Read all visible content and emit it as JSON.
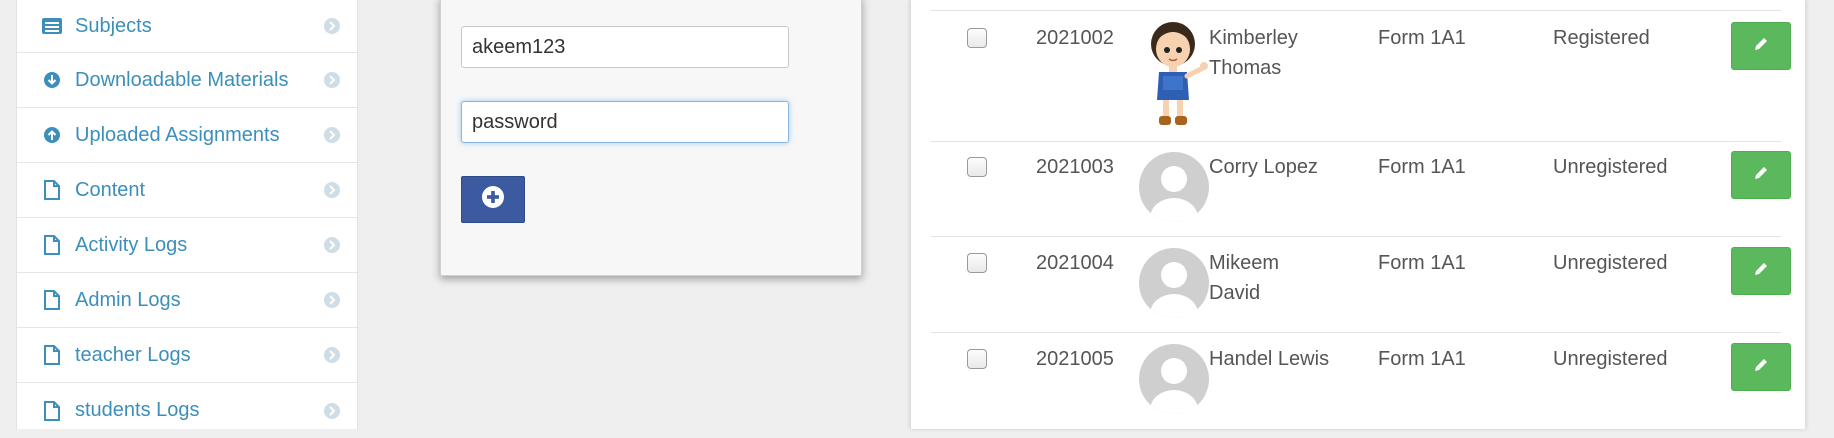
{
  "sidebar": {
    "items": [
      {
        "label": "Subjects",
        "icon": "list-icon"
      },
      {
        "label": "Downloadable Materials",
        "icon": "download-circle-icon"
      },
      {
        "label": "Uploaded Assignments",
        "icon": "upload-circle-icon"
      },
      {
        "label": "Content",
        "icon": "file-icon"
      },
      {
        "label": "Activity Logs",
        "icon": "file-icon"
      },
      {
        "label": "Admin Logs",
        "icon": "file-icon"
      },
      {
        "label": "teacher Logs",
        "icon": "file-icon"
      },
      {
        "label": "students Logs",
        "icon": "file-icon"
      }
    ]
  },
  "form": {
    "username_value": "akeem123",
    "password_value": "password"
  },
  "table": {
    "rows": [
      {
        "id": "2021002",
        "name": "Kimberley Thomas",
        "class": "Form 1A1",
        "status": "Registered",
        "avatar": "cartoon-girl"
      },
      {
        "id": "2021003",
        "name": "Corry Lopez",
        "class": "Form 1A1",
        "status": "Unregistered",
        "avatar": "default"
      },
      {
        "id": "2021004",
        "name": "Mikeem David",
        "class": "Form 1A1",
        "status": "Unregistered",
        "avatar": "default"
      },
      {
        "id": "2021005",
        "name": "Handel Lewis",
        "class": "Form 1A1",
        "status": "Unregistered",
        "avatar": "default"
      }
    ]
  },
  "colors": {
    "link": "#3b8fba",
    "primary_button": "#3c5aa0",
    "edit_button": "#5cb85c"
  }
}
